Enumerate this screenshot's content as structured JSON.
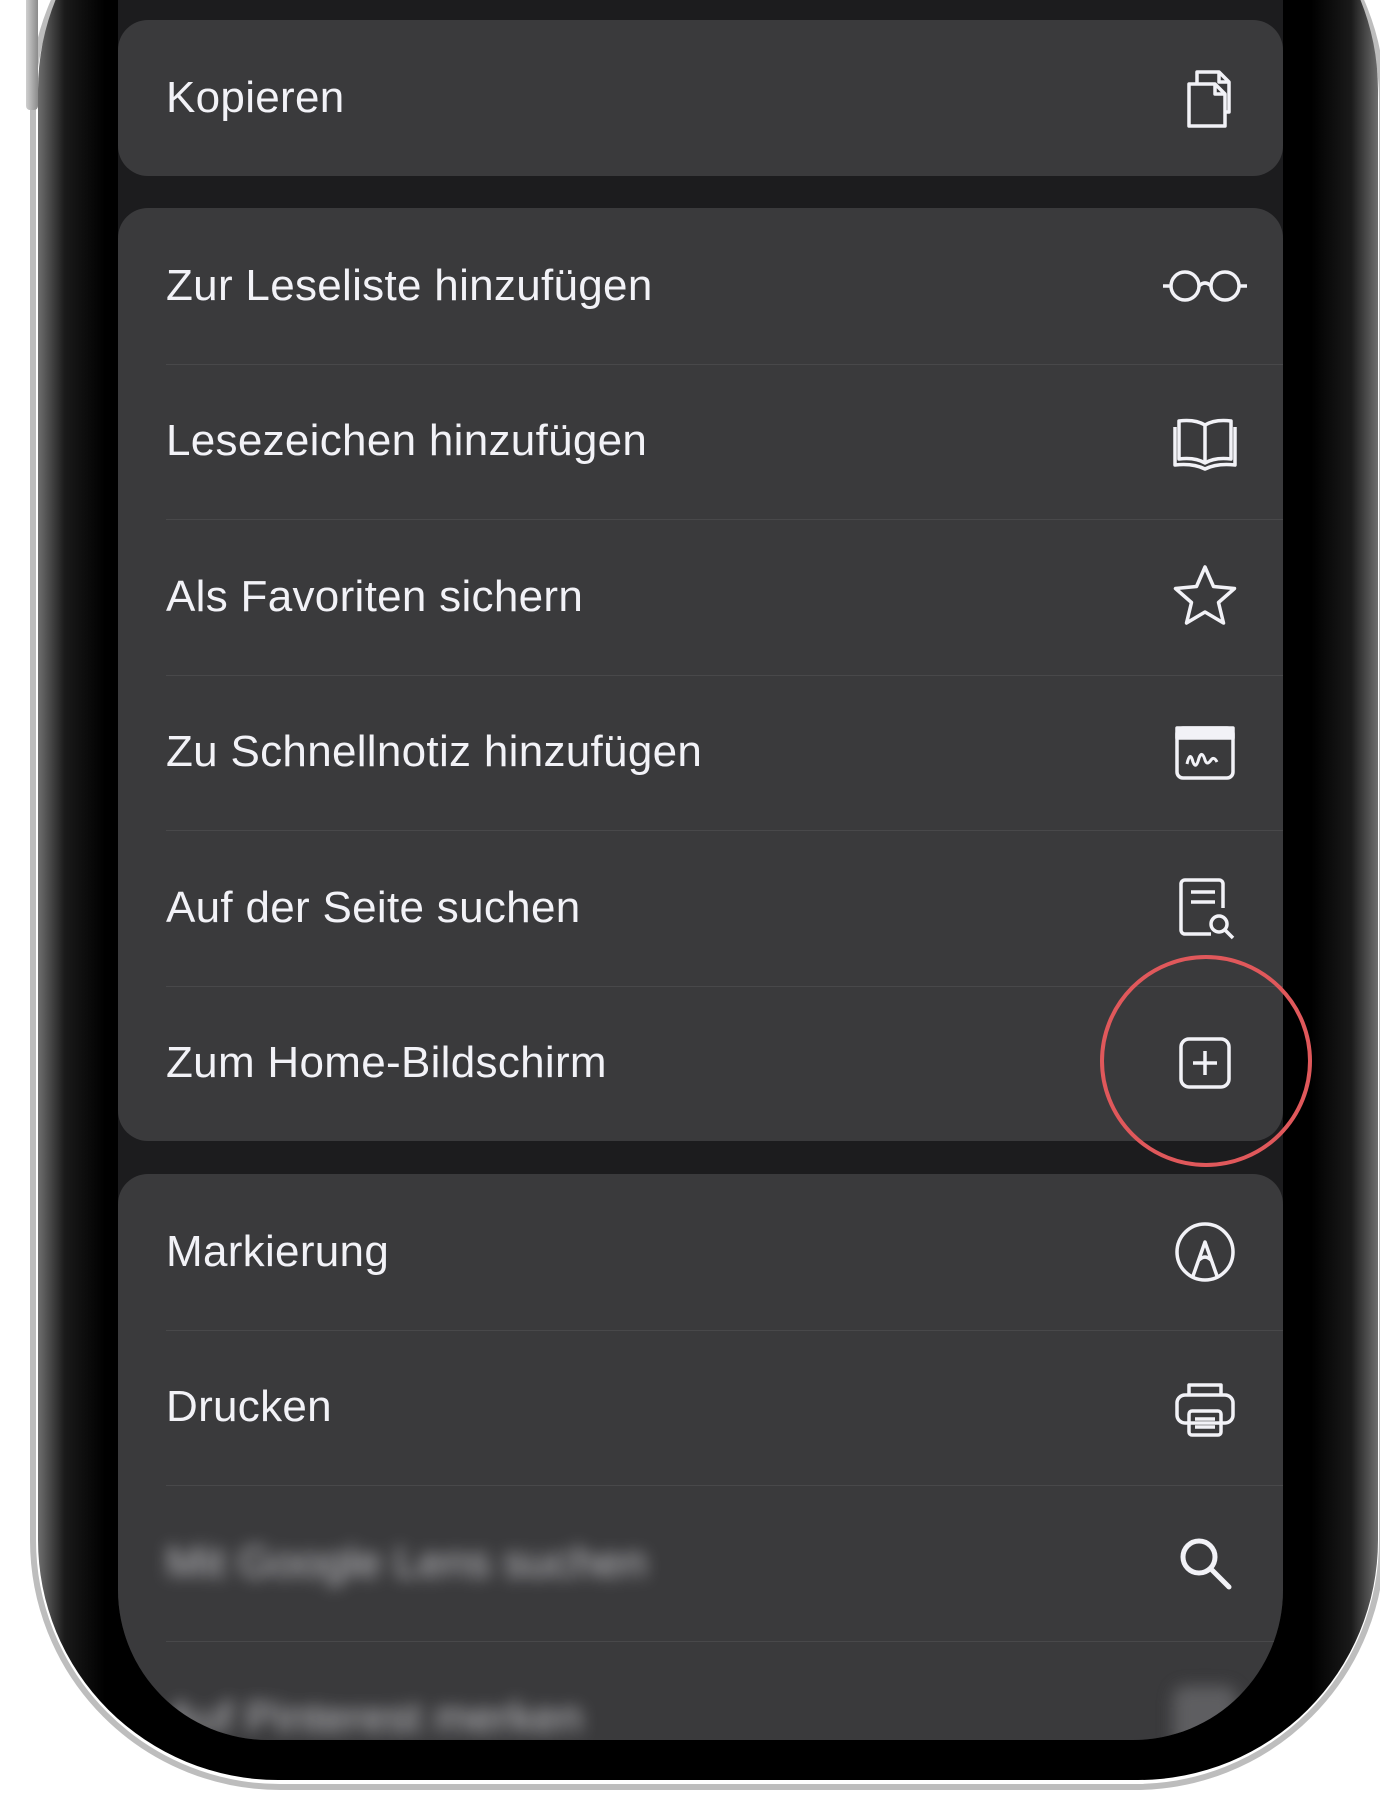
{
  "share_sheet": {
    "group_copy": [
      {
        "label": "Kopieren",
        "icon": "copy-icon"
      }
    ],
    "group_page": [
      {
        "label": "Zur Leseliste hinzufügen",
        "icon": "glasses-icon"
      },
      {
        "label": "Lesezeichen hinzufügen",
        "icon": "book-icon"
      },
      {
        "label": "Als Favoriten sichern",
        "icon": "star-icon"
      },
      {
        "label": "Zu Schnellnotiz hinzufügen",
        "icon": "quick-note-icon"
      },
      {
        "label": "Auf der Seite suchen",
        "icon": "find-on-page-icon"
      },
      {
        "label": "Zum Home-Bildschirm",
        "icon": "add-square-icon"
      }
    ],
    "group_tools": [
      {
        "label": "Markierung",
        "icon": "markup-icon"
      },
      {
        "label": "Drucken",
        "icon": "printer-icon"
      },
      {
        "label": "Mit Google Lens suchen",
        "icon": "search-icon"
      },
      {
        "label": "Auf Pinterest merken",
        "icon": "app-icon"
      }
    ]
  },
  "colors": {
    "screen_background": "#1c1c1e",
    "cell_background": "#3a3a3c",
    "text": "#f2f2f7",
    "separator": "#48484a",
    "highlight_ring": "#e0585b"
  }
}
